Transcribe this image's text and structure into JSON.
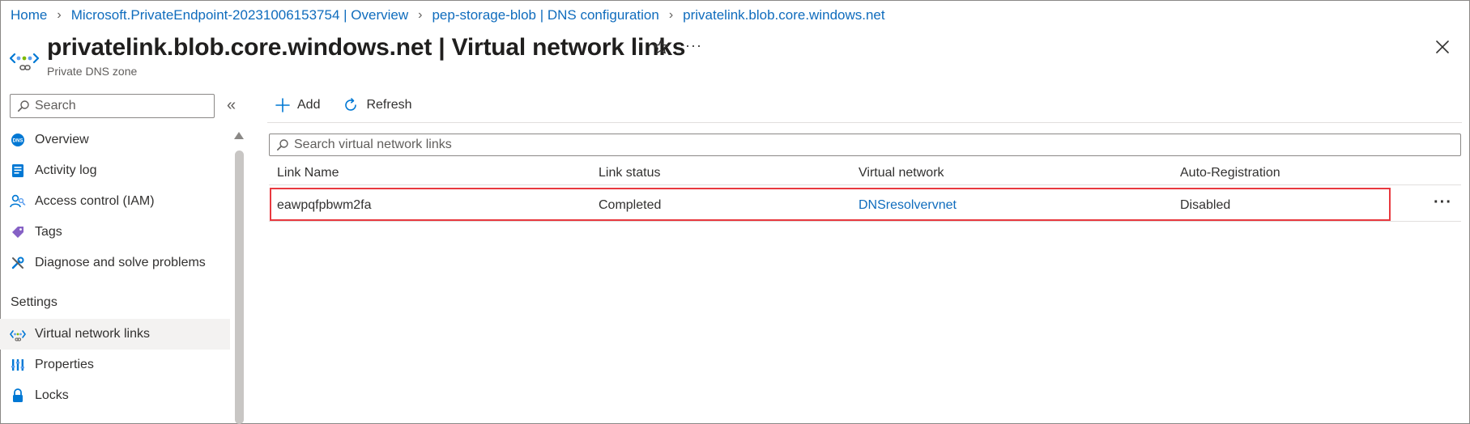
{
  "breadcrumb": [
    {
      "label": "Home"
    },
    {
      "label": "Microsoft.PrivateEndpoint-20231006153754 | Overview"
    },
    {
      "label": "pep-storage-blob | DNS configuration"
    },
    {
      "label": "privatelink.blob.core.windows.net"
    }
  ],
  "header": {
    "resource_name": "privatelink.blob.core.windows.net",
    "page_name": " | Virtual network links",
    "subtitle": "Private DNS zone",
    "more_label": "···"
  },
  "nav": {
    "search_placeholder": "Search",
    "collapse_label": "«",
    "items": [
      {
        "label": "Overview",
        "icon": "dns-icon"
      },
      {
        "label": "Activity log",
        "icon": "activity-log-icon"
      },
      {
        "label": "Access control (IAM)",
        "icon": "iam-icon"
      },
      {
        "label": "Tags",
        "icon": "tag-icon"
      },
      {
        "label": "Diagnose and solve problems",
        "icon": "wrench-icon"
      }
    ],
    "settings_heading": "Settings",
    "settings_items": [
      {
        "label": "Virtual network links",
        "icon": "virtual-network-icon",
        "selected": true
      },
      {
        "label": "Properties",
        "icon": "properties-icon"
      },
      {
        "label": "Locks",
        "icon": "lock-icon"
      }
    ]
  },
  "toolbar": {
    "add_label": "Add",
    "refresh_label": "Refresh"
  },
  "table": {
    "search_placeholder": "Search virtual network links",
    "columns": [
      "Link Name",
      "Link status",
      "Virtual network",
      "Auto-Registration"
    ],
    "rows": [
      {
        "link_name": "eawpqfpbwm2fa",
        "link_status": "Completed",
        "virtual_network": "DNSresolvervnet",
        "auto_registration": "Disabled",
        "more": "···"
      }
    ]
  },
  "colors": {
    "link": "#0f6cbd",
    "highlight": "#e8393f",
    "selected_bg": "#f3f2f1"
  }
}
